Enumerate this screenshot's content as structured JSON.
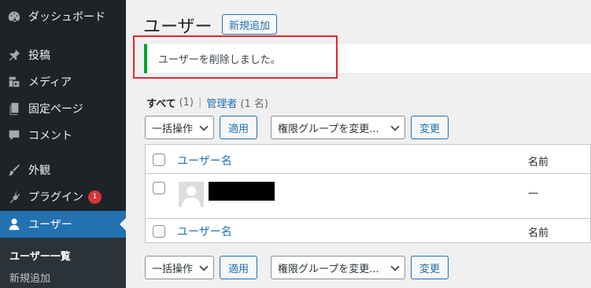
{
  "sidebar": {
    "items": [
      {
        "label": "ダッシュボード",
        "icon": "dashboard-icon"
      },
      {
        "label": "投稿",
        "icon": "pin-icon"
      },
      {
        "label": "メディア",
        "icon": "media-icon"
      },
      {
        "label": "固定ページ",
        "icon": "page-icon"
      },
      {
        "label": "コメント",
        "icon": "comment-icon"
      },
      {
        "label": "外観",
        "icon": "brush-icon"
      },
      {
        "label": "プラグイン",
        "icon": "plugin-icon",
        "badge": "1"
      },
      {
        "label": "ユーザー",
        "icon": "user-icon"
      }
    ],
    "submenu": {
      "current": "ユーザー一覧",
      "add_new": "新規追加"
    }
  },
  "page": {
    "title": "ユーザー",
    "add_new_label": "新規追加"
  },
  "notice": {
    "message": "ユーザーを削除しました。"
  },
  "filters": {
    "all_label": "すべて",
    "all_count": "(1)",
    "separator": "|",
    "admin_label": "管理者",
    "admin_count": "(1 名)"
  },
  "bulk": {
    "action_select": "一括操作",
    "apply_label": "適用",
    "role_select": "権限グループを変更...",
    "change_label": "変更"
  },
  "table": {
    "columns": {
      "username": "ユーザー名",
      "name": "名前"
    },
    "rows": [
      {
        "name": "—"
      }
    ]
  },
  "colors": {
    "sidebar_bg": "#1d2327",
    "accent": "#2271b1",
    "notice_border": "#00a32a",
    "highlight": "#e0282d",
    "badge": "#d63638"
  }
}
